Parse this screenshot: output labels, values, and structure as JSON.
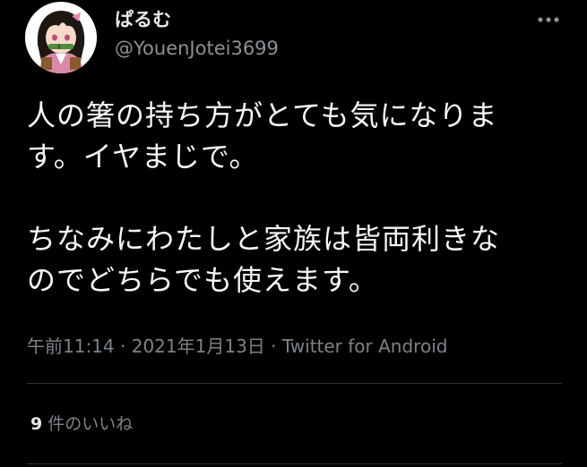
{
  "tweet": {
    "author": {
      "display_name": "ぱるむ",
      "handle": "@YouenJotei3699",
      "avatar_icon": "anime-character-avatar"
    },
    "more_icon": "more-options-icon",
    "paragraphs": [
      "人の箸の持ち方がとても気になります。イヤまじで。",
      "ちなみにわたしと家族は皆両利きなのでどちらでも使えます。"
    ],
    "paragraph_lines": [
      "人の箸の持ち方がとても気になりま\nす。イヤまじで。",
      "ちなみにわたしと家族は皆両利きな\nのでどちらでも使えます。"
    ],
    "time": "午前11:14",
    "separator": "·",
    "date": "2021年1月13日",
    "source": "Twitter for Android",
    "likes_count": "9",
    "likes_label": "件のいいね"
  },
  "colors": {
    "background": "#000000",
    "primary_text": "#e7e9ea",
    "secondary_text": "#7d8388",
    "divider": "#2f3336"
  }
}
